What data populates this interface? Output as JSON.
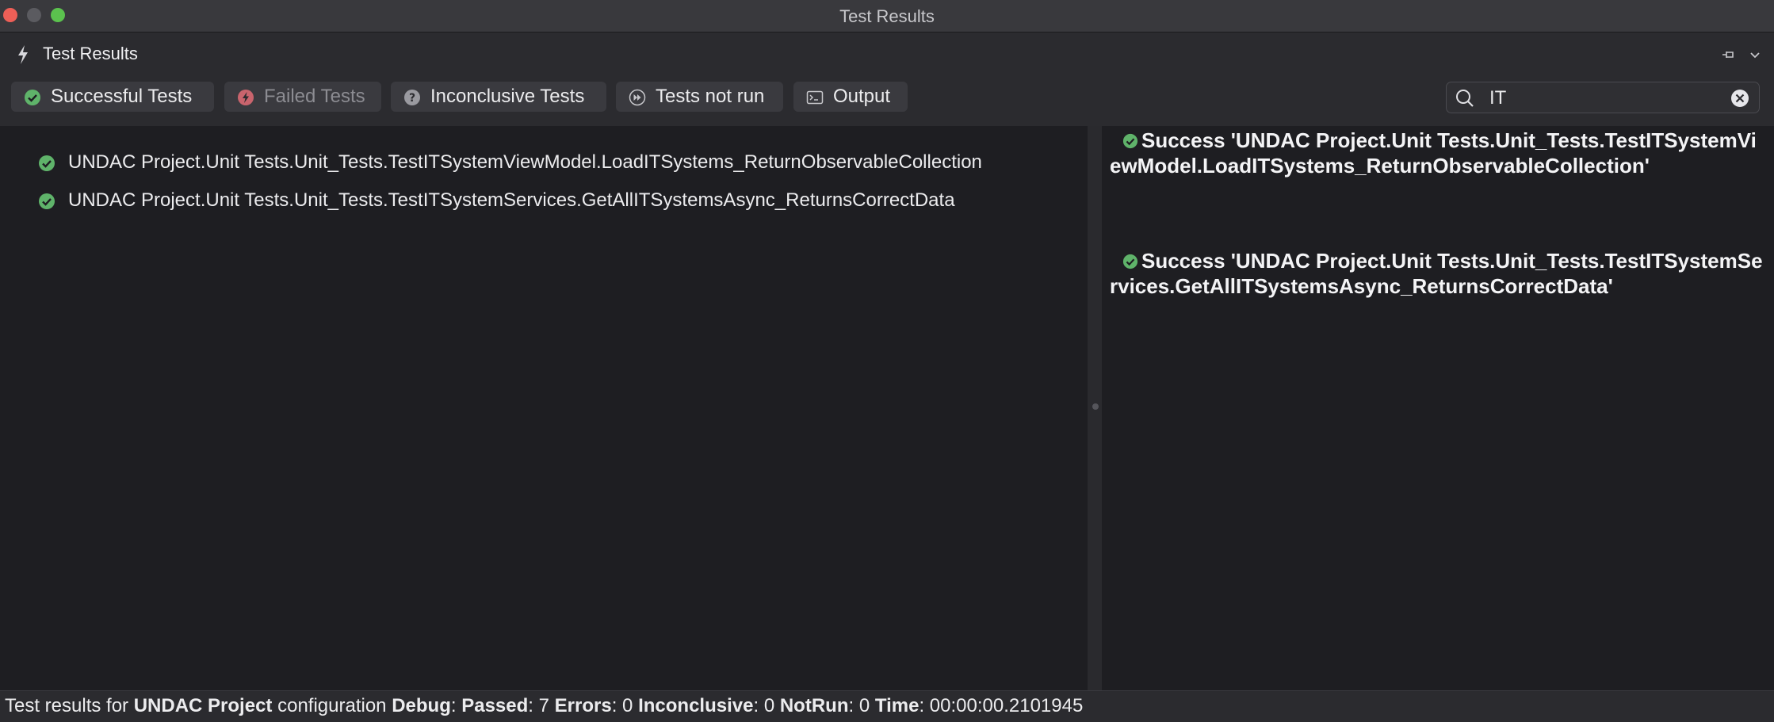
{
  "window": {
    "title": "Test Results"
  },
  "pad": {
    "title": "Test Results",
    "icon": "lightning-icon"
  },
  "toolbar": {
    "buttons": [
      {
        "label": "Successful Tests",
        "icon": "success-check-icon",
        "state": "active"
      },
      {
        "label": "Failed Tests",
        "icon": "failed-bolt-icon",
        "state": "disabled"
      },
      {
        "label": "Inconclusive Tests",
        "icon": "question-icon",
        "state": "active"
      },
      {
        "label": "Tests not run",
        "icon": "fast-forward-icon",
        "state": "active"
      },
      {
        "label": "Output",
        "icon": "terminal-icon",
        "state": "active"
      }
    ],
    "search": {
      "value": "IT",
      "placeholder": ""
    }
  },
  "results": [
    {
      "status": "success",
      "name": "UNDAC Project.Unit Tests.Unit_Tests.TestITSystemViewModel.LoadITSystems_ReturnObservableCollection"
    },
    {
      "status": "success",
      "name": "UNDAC Project.Unit Tests.Unit_Tests.TestITSystemServices.GetAllITSystemsAsync_ReturnsCorrectData"
    }
  ],
  "output": [
    {
      "text": "Success 'UNDAC Project.Unit Tests.Unit_Tests.TestITSystemViewModel.LoadITSystems_ReturnObservableCollection'"
    },
    {
      "text": "Success 'UNDAC Project.Unit Tests.Unit_Tests.TestITSystemServices.GetAllITSystemsAsync_ReturnsCorrectData'"
    }
  ],
  "status": {
    "prefix": "Test results for",
    "project": "UNDAC Project",
    "config_label": "configuration",
    "config": "Debug",
    "passed_label": "Passed",
    "passed": "7",
    "errors_label": "Errors",
    "errors": "0",
    "inconclusive_label": "Inconclusive",
    "inconclusive": "0",
    "notrun_label": "NotRun",
    "notrun": "0",
    "time_label": "Time",
    "time": "00:00:00.2101945"
  },
  "colors": {
    "success": "#5fb36a",
    "failed": "#e06c75",
    "background": "#1e1e22",
    "accent_close": "#ee5f57",
    "accent_max": "#5bc24e"
  }
}
